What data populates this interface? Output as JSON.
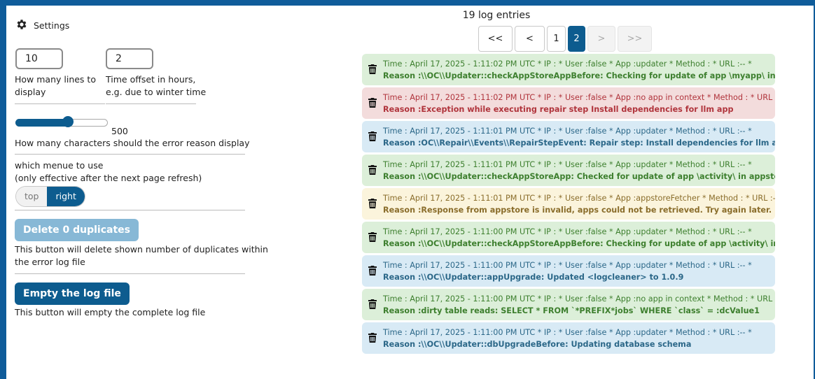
{
  "settings": {
    "heading": "Settings",
    "lines_value": "10",
    "lines_label_1": "How many lines to",
    "lines_label_2": "display",
    "offset_value": "2",
    "offset_label_1": "Time offset in hours,",
    "offset_label_2": "e.g. due to winter time",
    "slider_value": "500",
    "slider_fraction": 0.58,
    "slider_label": "How many characters should the error reason display",
    "menu_label_1": "which menue to use",
    "menu_label_2": "(only effective after the next page refresh)",
    "menu_options": [
      "top",
      "right"
    ],
    "menu_selected": "right",
    "dup_button": "Delete 0 duplicates",
    "dup_desc_1": "This button will delete shown number of duplicates within",
    "dup_desc_2": "the error log file",
    "empty_button": "Empty the log file",
    "empty_desc": "This button will empty the complete log file"
  },
  "log": {
    "count_text": "19 log entries",
    "pager": {
      "first": "<<",
      "prev": "<",
      "pages": [
        "1",
        "2"
      ],
      "current": "2",
      "next": ">",
      "last": ">>"
    },
    "entries": [
      {
        "level": "green",
        "meta": "Time : April 17, 2025 - 1:11:02 PM UTC * IP : * User :false * App :updater * Method : * URL :-- *",
        "reason": "Reason :\\\\OC\\\\Updater::checkAppStoreAppBefore: Checking for update of app \\myapp\\ in appstore"
      },
      {
        "level": "red",
        "meta": "Time : April 17, 2025 - 1:11:02 PM UTC * IP : * User :false * App :no app in context * Method : * URL :-- *",
        "reason": "Reason :Exception while executing repair step Install dependencies for llm app"
      },
      {
        "level": "blue",
        "meta": "Time : April 17, 2025 - 1:11:01 PM UTC * IP : * User :false * App :updater * Method : * URL :-- *",
        "reason": "Reason :OC\\\\Repair\\\\Events\\\\RepairStepEvent: Repair step: Install dependencies for llm app"
      },
      {
        "level": "green",
        "meta": "Time : April 17, 2025 - 1:11:01 PM UTC * IP : * User :false * App :updater * Method : * URL :-- *",
        "reason": "Reason :\\\\OC\\\\Updater::checkAppStoreApp: Checked for update of app \\activity\\ in appstore"
      },
      {
        "level": "yellow",
        "meta": "Time : April 17, 2025 - 1:11:01 PM UTC * IP : * User :false * App :appstoreFetcher * Method : * URL :-- *",
        "reason": "Reason :Response from appstore is invalid, apps could not be retrieved. Try again later."
      },
      {
        "level": "green",
        "meta": "Time : April 17, 2025 - 1:11:00 PM UTC * IP : * User :false * App :updater * Method : * URL :-- *",
        "reason": "Reason :\\\\OC\\\\Updater::checkAppStoreAppBefore: Checking for update of app \\activity\\ in appstore"
      },
      {
        "level": "blue",
        "meta": "Time : April 17, 2025 - 1:11:00 PM UTC * IP : * User :false * App :updater * Method : * URL :-- *",
        "reason": "Reason :\\\\OC\\\\Updater::appUpgrade: Updated <logcleaner> to 1.0.9"
      },
      {
        "level": "green",
        "meta": "Time : April 17, 2025 - 1:11:00 PM UTC * IP : * User :false * App :no app in context * Method : * URL :-- *",
        "reason": "Reason :dirty table reads: SELECT * FROM `*PREFIX*jobs` WHERE `class` = :dcValue1"
      },
      {
        "level": "blue",
        "meta": "Time : April 17, 2025 - 1:11:00 PM UTC * IP : * User :false * App :updater * Method : * URL :-- *",
        "reason": "Reason :\\\\OC\\\\Updater::dbUpgradeBefore: Updating database schema"
      }
    ]
  }
}
